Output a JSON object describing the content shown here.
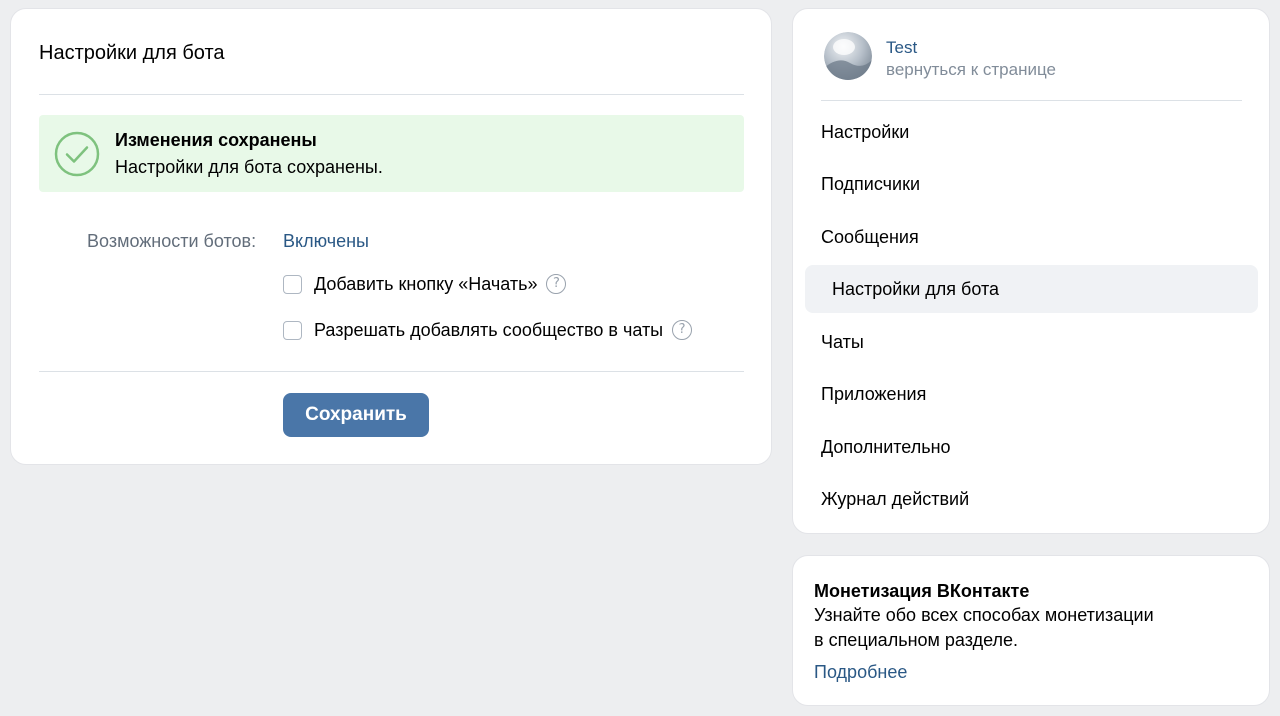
{
  "main": {
    "title": "Настройки для бота",
    "notice": {
      "title": "Изменения сохранены",
      "text": "Настройки для бота сохранены."
    },
    "bot_capabilities": {
      "label": "Возможности ботов:",
      "value": "Включены"
    },
    "options": [
      {
        "label": "Добавить кнопку «Начать»",
        "checked": false
      },
      {
        "label": "Разрешать добавлять сообщество в чаты",
        "checked": false
      }
    ],
    "help_glyph": "?",
    "save_label": "Сохранить"
  },
  "sidebar": {
    "community_name": "Test",
    "back_link": "вернуться к странице",
    "items": [
      {
        "label": "Настройки"
      },
      {
        "label": "Подписчики"
      },
      {
        "label": "Сообщения"
      },
      {
        "label": "Настройки для бота",
        "active": true
      },
      {
        "label": "Чаты"
      },
      {
        "label": "Приложения"
      },
      {
        "label": "Дополнительно"
      },
      {
        "label": "Журнал действий"
      }
    ]
  },
  "promo": {
    "title": "Монетизация ВКонтакте",
    "text_line1": "Узнайте обо всех способах монетизации",
    "text_line2": "в специальном разделе.",
    "link": "Подробнее"
  },
  "colors": {
    "background": "#edeef0",
    "accent": "#4a76a8",
    "link": "#2a5885",
    "success_bg": "#e8f9e8",
    "success_icon": "#7ec27e"
  },
  "icons": {
    "success": "check-circle-icon",
    "help": "question-circle-icon",
    "avatar": "community-avatar"
  }
}
